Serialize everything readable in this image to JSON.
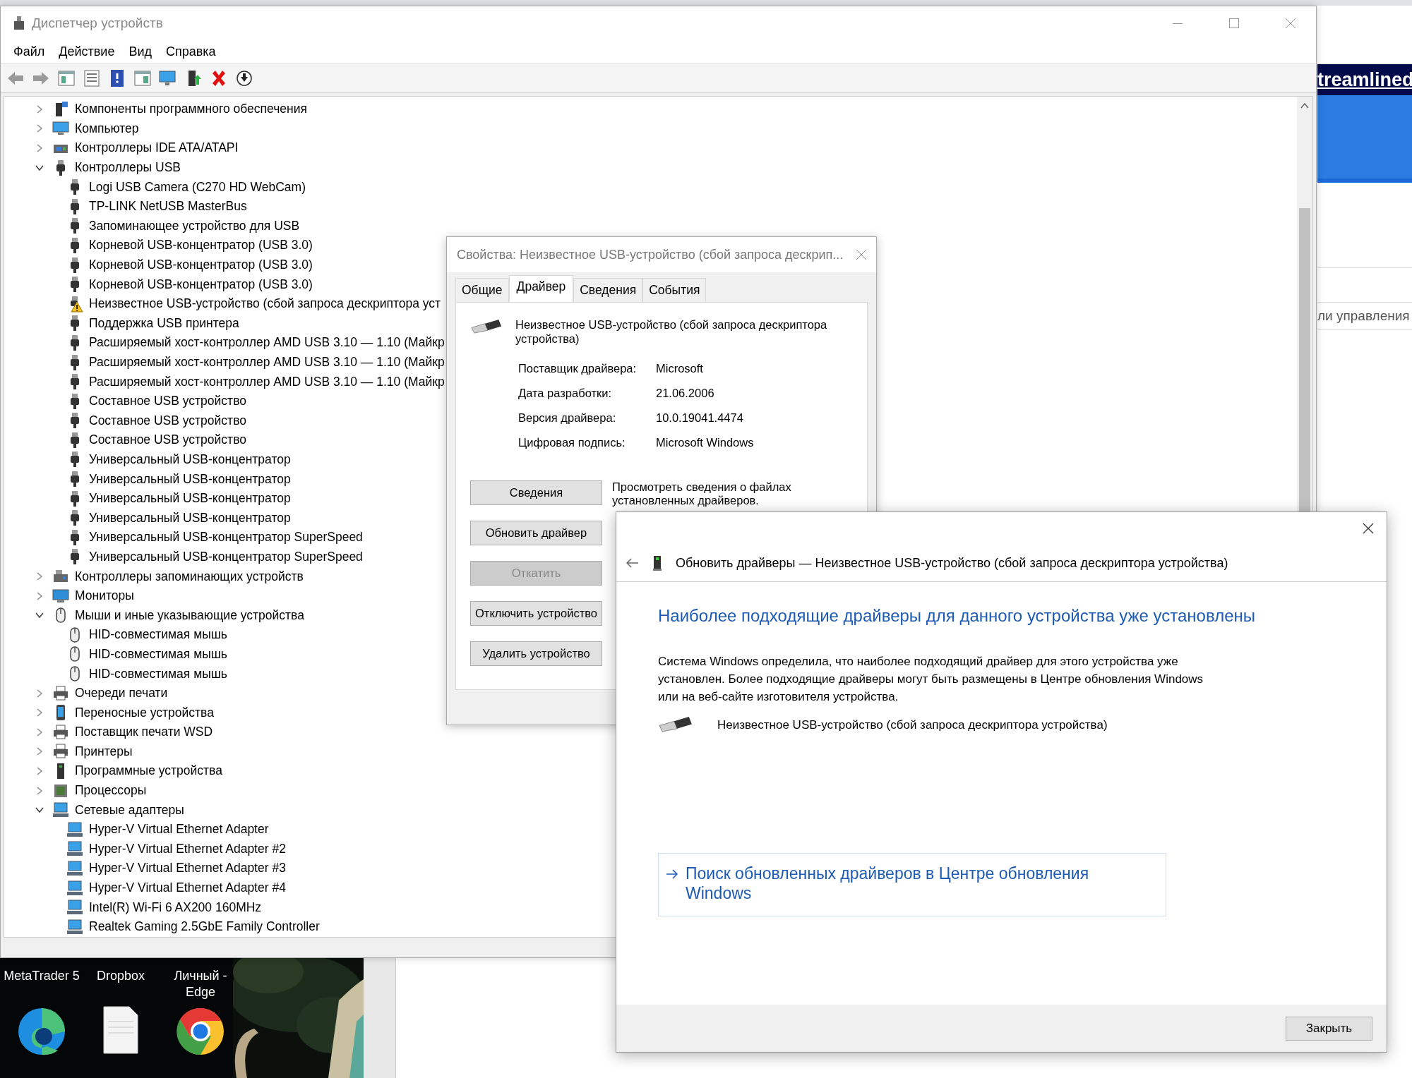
{
  "background": {
    "banner": "treamlined",
    "side_text": "ли управления",
    "desktop_icons": [
      {
        "label": "MetaTrader 5"
      },
      {
        "label": "Dropbox"
      },
      {
        "label": "Личный -\nEdge"
      }
    ],
    "desktop_tiles": [
      {
        "kind": "edge"
      },
      {
        "kind": "file"
      },
      {
        "kind": "chrome"
      }
    ]
  },
  "device_manager": {
    "title": "Диспетчер устройств",
    "menu": [
      "Файл",
      "Действие",
      "Вид",
      "Справка"
    ],
    "toolbar": [
      {
        "kind": "back"
      },
      {
        "kind": "forward"
      },
      {
        "kind": "properties"
      },
      {
        "kind": "list"
      },
      {
        "kind": "help"
      },
      {
        "kind": "view"
      },
      {
        "kind": "scan"
      },
      {
        "kind": "add"
      },
      {
        "kind": "remove"
      },
      {
        "kind": "download"
      }
    ],
    "tree": [
      {
        "label": "Компоненты программного обеспечения",
        "kind": "software",
        "expanded": false
      },
      {
        "label": "Компьютер",
        "kind": "computer",
        "expanded": false
      },
      {
        "label": "Контроллеры IDE ATA/ATAPI",
        "kind": "ide",
        "expanded": false
      },
      {
        "label": "Контроллеры USB",
        "kind": "usb",
        "expanded": true,
        "children": [
          {
            "label": "Logi USB Camera (C270 HD WebCam)",
            "kind": "usb"
          },
          {
            "label": "TP-LINK NetUSB MasterBus",
            "kind": "usb"
          },
          {
            "label": "Запоминающее устройство для USB",
            "kind": "usb"
          },
          {
            "label": "Корневой USB-концентратор (USB 3.0)",
            "kind": "usb"
          },
          {
            "label": "Корневой USB-концентратор (USB 3.0)",
            "kind": "usb"
          },
          {
            "label": "Корневой USB-концентратор (USB 3.0)",
            "kind": "usb"
          },
          {
            "label": "Неизвестное USB-устройство (сбой запроса дескриптора уст",
            "kind": "warning"
          },
          {
            "label": "Поддержка USB принтера",
            "kind": "usb"
          },
          {
            "label": "Расширяемый хост-контроллер AMD USB 3.10 — 1.10 (Майкр",
            "kind": "usb"
          },
          {
            "label": "Расширяемый хост-контроллер AMD USB 3.10 — 1.10 (Майкр",
            "kind": "usb"
          },
          {
            "label": "Расширяемый хост-контроллер AMD USB 3.10 — 1.10 (Майкр",
            "kind": "usb"
          },
          {
            "label": "Составное USB устройство",
            "kind": "usb"
          },
          {
            "label": "Составное USB устройство",
            "kind": "usb"
          },
          {
            "label": "Составное USB устройство",
            "kind": "usb"
          },
          {
            "label": "Универсальный USB-концентратор",
            "kind": "usb"
          },
          {
            "label": "Универсальный USB-концентратор",
            "kind": "usb"
          },
          {
            "label": "Универсальный USB-концентратор",
            "kind": "usb"
          },
          {
            "label": "Универсальный USB-концентратор",
            "kind": "usb"
          },
          {
            "label": "Универсальный USB-концентратор SuperSpeed",
            "kind": "usb"
          },
          {
            "label": "Универсальный USB-концентратор SuperSpeed",
            "kind": "usb"
          }
        ]
      },
      {
        "label": "Контроллеры запоминающих устройств",
        "kind": "storage",
        "expanded": false
      },
      {
        "label": "Мониторы",
        "kind": "monitor",
        "expanded": false
      },
      {
        "label": "Мыши и иные указывающие устройства",
        "kind": "mouse",
        "expanded": true,
        "children": [
          {
            "label": "HID-совместимая мышь",
            "kind": "mouse"
          },
          {
            "label": "HID-совместимая мышь",
            "kind": "mouse"
          },
          {
            "label": "HID-совместимая мышь",
            "kind": "mouse"
          }
        ]
      },
      {
        "label": "Очереди печати",
        "kind": "printer",
        "expanded": false
      },
      {
        "label": "Переносные устройства",
        "kind": "portable",
        "expanded": false
      },
      {
        "label": "Поставщик печати WSD",
        "kind": "printer",
        "expanded": false
      },
      {
        "label": "Принтеры",
        "kind": "printer",
        "expanded": false
      },
      {
        "label": "Программные устройства",
        "kind": "softdev",
        "expanded": false
      },
      {
        "label": "Процессоры",
        "kind": "cpu",
        "expanded": false
      },
      {
        "label": "Сетевые адаптеры",
        "kind": "network",
        "expanded": true,
        "children": [
          {
            "label": "Hyper-V Virtual Ethernet Adapter",
            "kind": "network"
          },
          {
            "label": "Hyper-V Virtual Ethernet Adapter #2",
            "kind": "network"
          },
          {
            "label": "Hyper-V Virtual Ethernet Adapter #3",
            "kind": "network"
          },
          {
            "label": "Hyper-V Virtual Ethernet Adapter #4",
            "kind": "network"
          },
          {
            "label": "Intel(R) Wi-Fi 6 AX200 160MHz",
            "kind": "network"
          },
          {
            "label": "Realtek Gaming 2.5GbE Family Controller",
            "kind": "network"
          }
        ]
      }
    ]
  },
  "properties": {
    "title": "Свойства: Неизвестное USB-устройство (сбой запроса дескрип...",
    "tabs": [
      {
        "label": "Общие",
        "selected": false
      },
      {
        "label": "Драйвер",
        "selected": true
      },
      {
        "label": "Сведения",
        "selected": false
      },
      {
        "label": "События",
        "selected": false
      }
    ],
    "device_name": "Неизвестное USB-устройство (сбой запроса дескриптора устройства)",
    "fields": [
      {
        "label": "Поставщик драйвера:",
        "value": "Microsoft"
      },
      {
        "label": "Дата разработки:",
        "value": "21.06.2006"
      },
      {
        "label": "Версия драйвера:",
        "value": "10.0.19041.4474"
      },
      {
        "label": "Цифровая подпись:",
        "value": "Microsoft Windows"
      }
    ],
    "buttons": [
      {
        "label": "Сведения",
        "disabled": false,
        "description": "Просмотреть сведения о файлах установленных драйверов."
      },
      {
        "label": "Обновить драйвер",
        "disabled": false
      },
      {
        "label": "Откатить",
        "disabled": true
      },
      {
        "label": "Отключить устройство",
        "disabled": false
      },
      {
        "label": "Удалить устройство",
        "disabled": false
      }
    ]
  },
  "update_dialog": {
    "header": "Обновить драйверы — Неизвестное USB-устройство (сбой запроса дескриптора устройства)",
    "heading": "Наиболее подходящие драйверы для данного устройства уже установлены",
    "paragraph": "Система Windows определила, что наиболее подходящий драйвер для этого устройства уже установлен. Более подходящие драйверы могут быть размещены в Центре обновления Windows или на веб-сайте изготовителя устройства.",
    "device_name": "Неизвестное USB-устройство (сбой запроса дескриптора устройства)",
    "link": "Поиск обновленных драйверов в Центре обновления Windows",
    "close_button": "Закрыть"
  }
}
